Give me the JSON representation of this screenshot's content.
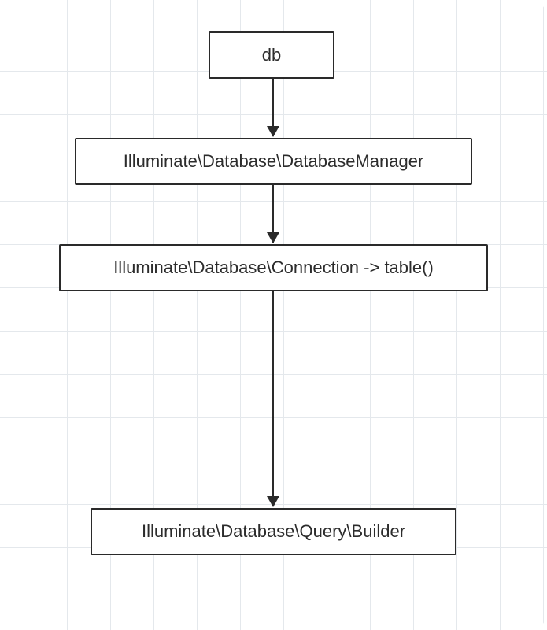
{
  "diagram": {
    "nodes": [
      {
        "id": "n1",
        "label": "db"
      },
      {
        "id": "n2",
        "label": "Illuminate\\Database\\DatabaseManager"
      },
      {
        "id": "n3",
        "label": "Illuminate\\Database\\Connection -> table()"
      },
      {
        "id": "n4",
        "label": "Illuminate\\Database\\Query\\Builder"
      }
    ],
    "edges": [
      {
        "from": "n1",
        "to": "n2"
      },
      {
        "from": "n2",
        "to": "n3"
      },
      {
        "from": "n3",
        "to": "n4"
      }
    ]
  }
}
